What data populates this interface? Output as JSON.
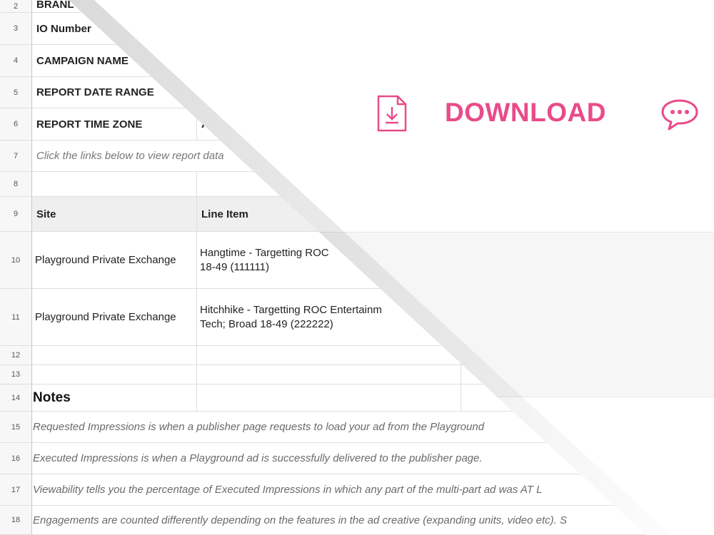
{
  "download": {
    "label": "DOWNLOAD",
    "icon": "file-download-icon",
    "chat_icon": "chat-bubble-icon",
    "accent_color": "#e94b8a"
  },
  "sheet": {
    "rows": [
      {
        "num": "2",
        "a": "BRANL"
      },
      {
        "num": "3",
        "a": "IO Number"
      },
      {
        "num": "4",
        "a": "CAMPAIGN NAME"
      },
      {
        "num": "5",
        "a": "REPORT DATE RANGE"
      },
      {
        "num": "6",
        "a": "REPORT TIME ZONE",
        "b": "A"
      },
      {
        "num": "7",
        "a": "Click the links below to view report data"
      },
      {
        "num": "8"
      },
      {
        "num": "9",
        "a": "Site",
        "b": "Line Item"
      },
      {
        "num": "10",
        "a": "Playground Private Exchange",
        "b": "Hangtime - Targetting ROC\n18-49 (111111)"
      },
      {
        "num": "11",
        "a": "Playground Private Exchange",
        "b": "Hitchhike - Targetting ROC Entertainm\nTech; Broad 18-49 (222222)"
      },
      {
        "num": "12"
      },
      {
        "num": "13"
      },
      {
        "num": "14",
        "a": "Notes"
      },
      {
        "num": "15",
        "a": "Requested Impressions is when a publisher page requests to load your ad from the Playground"
      },
      {
        "num": "16",
        "a": "Executed Impressions is when a Playground ad is successfully delivered to the publisher page."
      },
      {
        "num": "17",
        "a": "Viewability tells you the percentage of Executed Impressions in which any part of the multi-part ad was AT L"
      },
      {
        "num": "18",
        "a": "Engagements are counted  differently depending on the features in the ad creative (expanding units, video etc). S"
      }
    ]
  }
}
